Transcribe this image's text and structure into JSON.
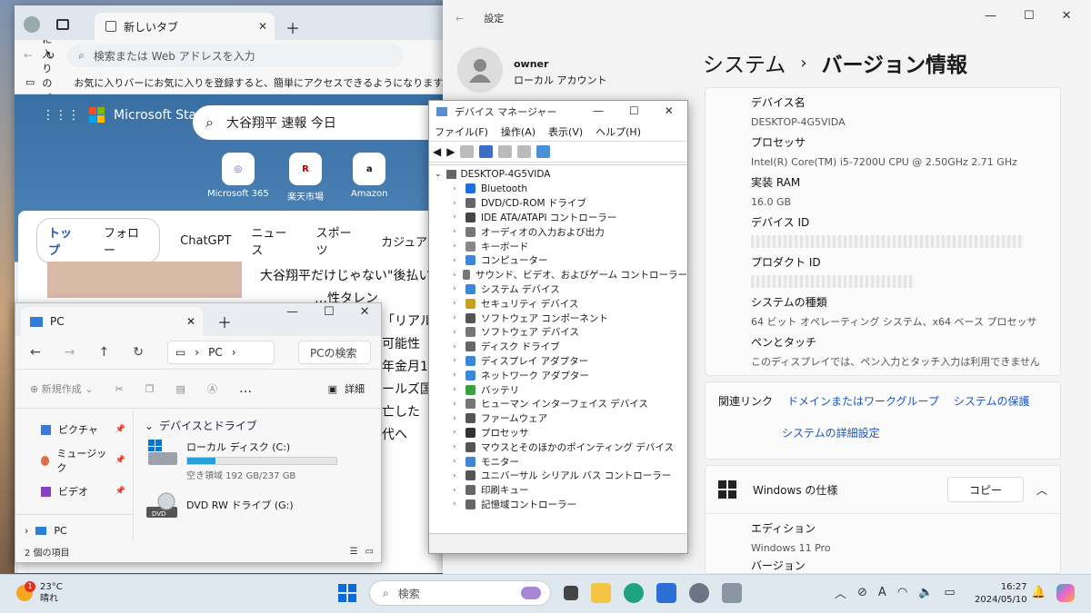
{
  "edge": {
    "tab_title": "新しいタブ",
    "address_placeholder": "検索または Web アドレスを入力",
    "fav_import": "お気に入りのインポート",
    "fav_hint": "お気に入りバーにお気に入りを登録すると、簡単にアクセスできるようになります。",
    "brand": "Microsoft Start",
    "search_query": "大谷翔平 速報 今日",
    "quick_links": [
      {
        "label": "Microsoft 365",
        "icon": "microsoft365-icon"
      },
      {
        "label": "楽天市場",
        "icon": "rakuten-icon",
        "glyph": "R"
      },
      {
        "label": "Amazon",
        "icon": "amazon-icon",
        "glyph": "a"
      }
    ],
    "feed_tabs": [
      "トップ",
      "フォロー",
      "ChatGPT",
      "ニュース",
      "スポーツ",
      "カジュアル ゲ"
    ],
    "headline_lines": [
      "大谷翔平だけじゃない\"後払い",
      "…性タレン",
      "「リアル",
      "可能性「",
      "年金月1",
      "ールズ国",
      "亡した",
      "代へ"
    ]
  },
  "explorer": {
    "tab_title": "PC",
    "path_label": "PC",
    "search_placeholder": "PCの検索",
    "new_button": "新規作成",
    "details_button": "詳細",
    "sidebar": [
      {
        "label": "ピクチャ",
        "icon": "pictures-icon",
        "color": "#3b7bd8"
      },
      {
        "label": "ミュージック",
        "icon": "music-icon",
        "color": "#e0704a"
      },
      {
        "label": "ビデオ",
        "icon": "videos-icon",
        "color": "#8a3fc6"
      }
    ],
    "sidebar_pc": "PC",
    "section_header": "デバイスとドライブ",
    "drives": [
      {
        "name": "ローカル ディスク (C:)",
        "free_text": "空き領域 192 GB/237 GB",
        "used_fraction": 0.19
      },
      {
        "name": "DVD RW ドライブ (G:)",
        "badge": "DVD"
      }
    ],
    "status": "2 個の項目"
  },
  "device_manager": {
    "title": "デバイス マネージャー",
    "menu": [
      "ファイル(F)",
      "操作(A)",
      "表示(V)",
      "ヘルプ(H)"
    ],
    "root": "DESKTOP-4G5VIDA",
    "items": [
      {
        "label": "Bluetooth",
        "color": "#1e6fd9"
      },
      {
        "label": "DVD/CD-ROM ドライブ",
        "color": "#666"
      },
      {
        "label": "IDE ATA/ATAPI コントローラー",
        "color": "#444"
      },
      {
        "label": "オーディオの入力および出力",
        "color": "#777"
      },
      {
        "label": "キーボード",
        "color": "#888"
      },
      {
        "label": "コンピューター",
        "color": "#3b88d8"
      },
      {
        "label": "サウンド、ビデオ、およびゲーム コントローラー",
        "color": "#777"
      },
      {
        "label": "システム デバイス",
        "color": "#3b88d8"
      },
      {
        "label": "セキュリティ デバイス",
        "color": "#c8a020"
      },
      {
        "label": "ソフトウェア コンポーネント",
        "color": "#555"
      },
      {
        "label": "ソフトウェア デバイス",
        "color": "#777"
      },
      {
        "label": "ディスク ドライブ",
        "color": "#666"
      },
      {
        "label": "ディスプレイ アダプター",
        "color": "#3b88d8"
      },
      {
        "label": "ネットワーク アダプター",
        "color": "#3b88d8"
      },
      {
        "label": "バッテリ",
        "color": "#3aa040"
      },
      {
        "label": "ヒューマン インターフェイス デバイス",
        "color": "#777"
      },
      {
        "label": "ファームウェア",
        "color": "#555"
      },
      {
        "label": "プロセッサ",
        "color": "#333"
      },
      {
        "label": "マウスとそのほかのポインティング デバイス",
        "color": "#555"
      },
      {
        "label": "モニター",
        "color": "#3b88d8"
      },
      {
        "label": "ユニバーサル シリアル バス コントローラー",
        "color": "#555"
      },
      {
        "label": "印刷キュー",
        "color": "#666"
      },
      {
        "label": "記憶域コントローラー",
        "color": "#666"
      }
    ]
  },
  "settings": {
    "title": "設定",
    "user_name": "owner",
    "account_type": "ローカル アカウント",
    "breadcrumb_parent": "システム",
    "breadcrumb_current": "バージョン情報",
    "specs": [
      {
        "label": "デバイス名",
        "value": "DESKTOP-4G5VIDA"
      },
      {
        "label": "プロセッサ",
        "value": "Intel(R) Core(TM) i5-7200U CPU @ 2.50GHz   2.71 GHz"
      },
      {
        "label": "実装 RAM",
        "value": "16.0 GB"
      },
      {
        "label": "デバイス ID",
        "value": ""
      },
      {
        "label": "プロダクト ID",
        "value": ""
      },
      {
        "label": "システムの種類",
        "value": "64 ビット オペレーティング システム、x64 ベース プロセッサ"
      },
      {
        "label": "ペンとタッチ",
        "value": "このディスプレイでは、ペン入力とタッチ入力は利用できません"
      }
    ],
    "related_links_label": "関連リンク",
    "link_domain": "ドメインまたはワークグループ",
    "link_protection": "システムの保護",
    "link_advanced": "システムの詳細設定",
    "windows_spec_title": "Windows の仕様",
    "copy_button": "コピー",
    "edition_label": "エディション",
    "edition_value": "Windows 11 Pro",
    "version_label": "バージョン"
  },
  "taskbar": {
    "temperature": "23°C",
    "weather": "晴れ",
    "badge": "1",
    "search_placeholder": "検索",
    "ime": "A",
    "time": "16:27",
    "date": "2024/05/10",
    "accent": "#0a6cd8"
  }
}
